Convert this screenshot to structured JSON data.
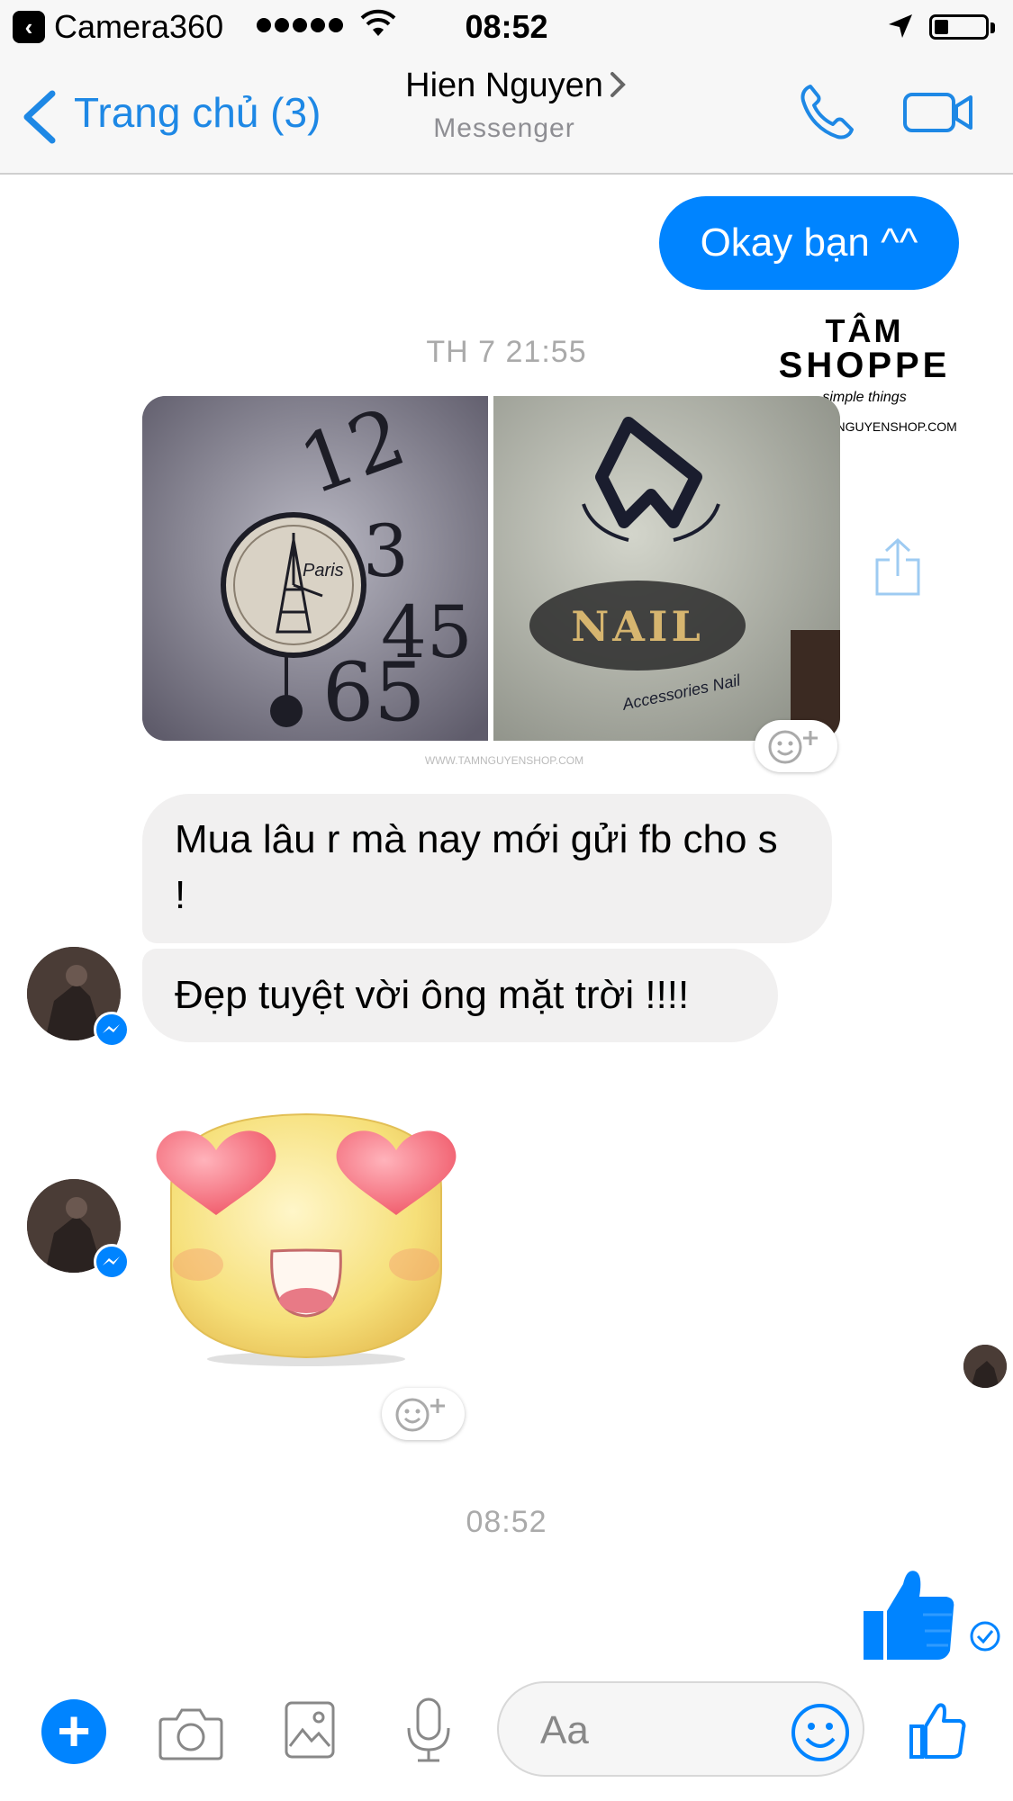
{
  "status_bar": {
    "back_app": "Camera360",
    "time": "08:52"
  },
  "nav": {
    "back_label": "Trang chủ (3)",
    "contact_name": "Hien Nguyen",
    "contact_sub": "Messenger"
  },
  "messages": {
    "outgoing_1": "Okay bạn ^^",
    "timestamp_1": "TH 7 21:55",
    "incoming_1": "Mua lâu r mà nay mới gửi fb cho s !",
    "incoming_2": "Đẹp tuyệt vời ông mặt trời !!!!",
    "timestamp_2": "08:52"
  },
  "photos": {
    "left_caption": "Paris",
    "right_sign": "NAIL",
    "right_caption": "Accessories Nail"
  },
  "watermark": {
    "brand_line1": "TÂM",
    "brand_line2": "SHOPPE",
    "tagline": "simple things",
    "url": "WWW.TAMNGUYENSHOP.COM"
  },
  "composer": {
    "placeholder": "Aa"
  },
  "colors": {
    "accent": "#0084ff",
    "nav_tint": "#1e88e5",
    "incoming_bubble": "#f1f0f0"
  }
}
